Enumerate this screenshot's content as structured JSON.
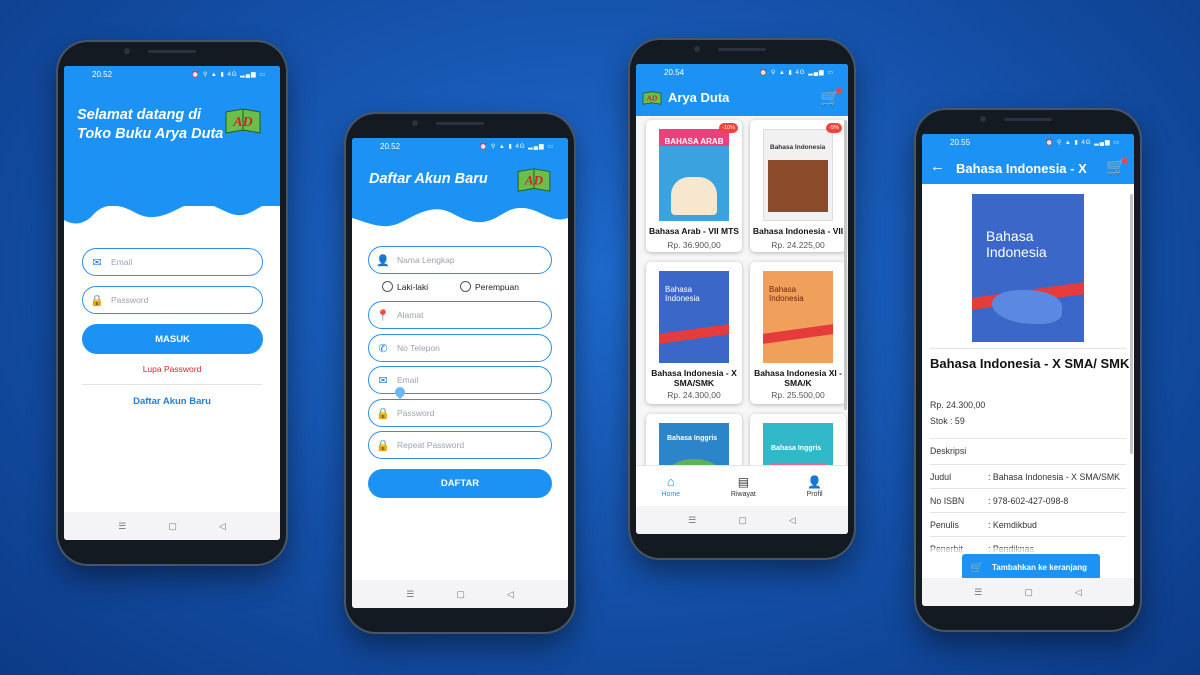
{
  "login": {
    "time": "20.52",
    "status_icons": "⏰ ⚲ ▲ ▮ 4G ▂▄▆ ▭",
    "greeting_line1": "Selamat datang di",
    "greeting_line2": "Toko Buku Arya Duta",
    "logo_text": "AD",
    "email_placeholder": "Email",
    "password_placeholder": "Password",
    "login_button": "MASUK",
    "forgot_password": "Lupa Password",
    "register_link": "Daftar Akun Baru"
  },
  "register": {
    "time": "20.52",
    "status_icons": "⏰ ⚲ ▲ ▮ 4G ▂▄▆ ▭",
    "title": "Daftar Akun Baru",
    "logo_text": "AD",
    "name_placeholder": "Nama Lengkap",
    "gender_male": "Laki-laki",
    "gender_female": "Perempuan",
    "address_placeholder": "Alamat",
    "phone_placeholder": "No Telepon",
    "email_placeholder": "Email",
    "password_placeholder": "Password",
    "repeat_password_placeholder": "Repeat Password",
    "submit_button": "DAFTAR"
  },
  "home": {
    "time": "20.54",
    "status_icons": "⏰ ⚲ ▲ ▮ 4G ▂▄▆ ▭",
    "app_title": "Arya Duta",
    "books": [
      {
        "title": "Bahasa Arab - VII MTS",
        "price": "Rp. 36.900,00",
        "discount": "-10%",
        "cover_text": "BAHASA ARAB",
        "cover_color": "#3aa3df"
      },
      {
        "title": "Bahasa Indonesia - VII",
        "price": "Rp. 24.225,00",
        "discount": "-5%",
        "cover_text": "Bahasa Indonesia",
        "cover_color": "#f1f1f1"
      },
      {
        "title": "Bahasa Indonesia - X SMA/SMK",
        "price": "Rp. 24.300,00",
        "cover_text": "Bahasa Indonesia",
        "cover_color": "#3b67c9"
      },
      {
        "title": "Bahasa Indonesia XI - SMA/K",
        "price": "Rp. 25.500,00",
        "cover_text": "Bahasa Indonesia",
        "cover_color": "#f0a05a"
      },
      {
        "title": "Bahasa Inggris",
        "cover_text": "Bahasa Inggris",
        "cover_color": "#2c84c9"
      },
      {
        "title": "Bahasa Inggris",
        "cover_text": "Bahasa Inggris",
        "cover_color": "#32b9c9"
      }
    ],
    "nav": [
      {
        "label": "Home",
        "icon": "home-icon"
      },
      {
        "label": "Riwayat",
        "icon": "history-icon"
      },
      {
        "label": "Profil",
        "icon": "profile-icon"
      }
    ]
  },
  "detail": {
    "time": "20.55",
    "status_icons": "⏰ ⚲ ▲ ▮ 4G ▂▄▆ ▭",
    "header_title": "Bahasa Indonesia - X",
    "cover_text": "Bahasa Indonesia",
    "book_title": "Bahasa Indonesia - X SMA/ SMK",
    "price": "Rp. 24.300,00",
    "stock": "Stok : 59",
    "description_label": "Deskripsi",
    "rows": [
      {
        "key": "Judul",
        "value": ": Bahasa Indonesia - X SMA/SMK"
      },
      {
        "key": "No ISBN",
        "value": ": 978-602-427-098-8"
      },
      {
        "key": "Penulis",
        "value": ": Kemdikbud"
      },
      {
        "key": "Penerbit",
        "value": ": Pendiknas"
      }
    ],
    "add_to_cart": "Tambahkan ke keranjang"
  },
  "colors": {
    "primary": "#1c93f4",
    "accent_red": "#d0262e",
    "background": "#1450a8"
  }
}
